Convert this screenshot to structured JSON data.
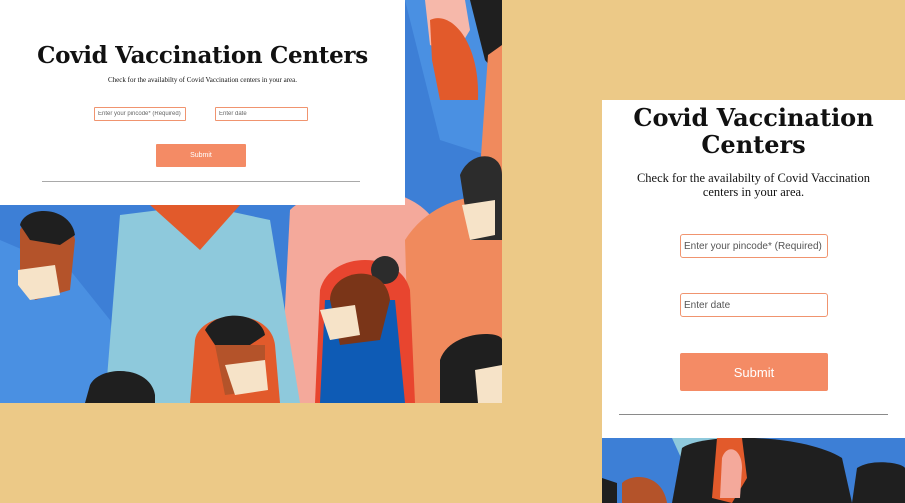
{
  "desktop": {
    "title": "Covid Vaccination Centers",
    "subtitle": "Check for the availabilty of Covid Vaccination centers in your area.",
    "pincode_placeholder": "Enter your pincode* (Required)",
    "date_placeholder": "Enter date",
    "submit_label": "Submit"
  },
  "mobile": {
    "title": "Covid Vaccination Centers",
    "subtitle": "Check for the availabilty of Covid Vaccination centers in your area.",
    "pincode_placeholder": "Enter your pincode* (Required)",
    "date_placeholder": "Enter date",
    "submit_label": "Submit"
  },
  "colors": {
    "background": "#ecc987",
    "accent": "#f48b65",
    "input_border": "#f0946f"
  },
  "illustration": "crowd-of-people-wearing-masks"
}
